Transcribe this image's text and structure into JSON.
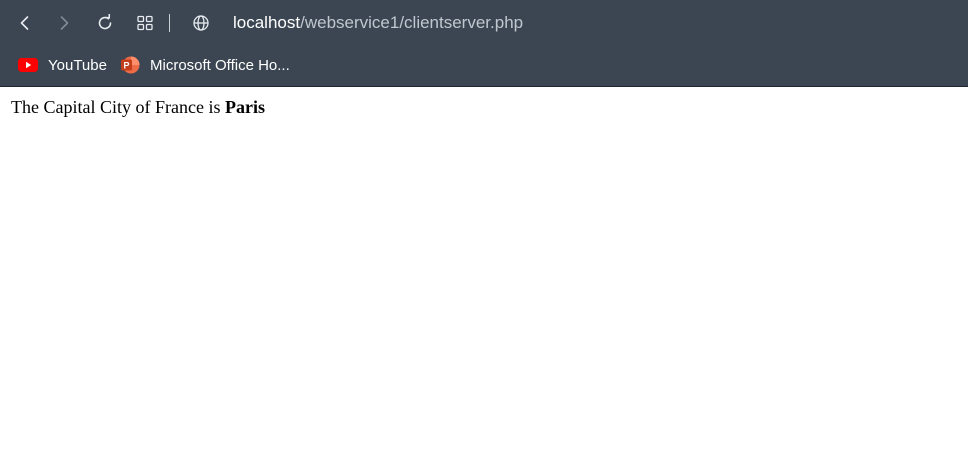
{
  "browser": {
    "address": {
      "host": "localhost",
      "path": "/webservice1/clientserver.php"
    },
    "bookmarks": [
      {
        "label": "YouTube",
        "icon": "youtube-icon"
      },
      {
        "label": "Microsoft Office Ho...",
        "icon": "powerpoint-icon"
      }
    ],
    "toolbar_icons": [
      "back-icon",
      "forward-icon",
      "reload-icon",
      "apps-grid-icon",
      "globe-icon"
    ],
    "colors": {
      "toolbar_bg": "#3b4652",
      "youtube_red": "#ff0000",
      "powerpoint_orange": "#d24726"
    }
  },
  "page": {
    "sentence": "The Capital City of France is",
    "answer": "Paris"
  }
}
